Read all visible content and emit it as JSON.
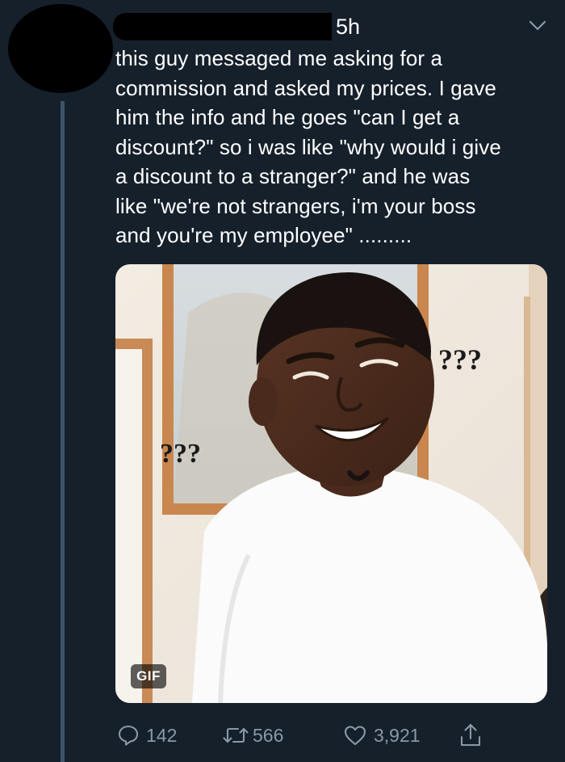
{
  "tweet": {
    "timestamp": "5h",
    "text": "this guy messaged me asking for a\ncommission and asked my prices. I gave\nhim the info and he goes \"can I get a\ndiscount?\" so i was like \"why would i give\na discount to a stranger?\" and he was\nlike \"we're not strangers, i'm your boss\nand you're my employee\" .........",
    "media": {
      "badge": "GIF",
      "caption_right": "???",
      "caption_left": "???"
    },
    "actions": {
      "replies": "142",
      "retweets": "566",
      "likes": "3,921"
    }
  },
  "colors": {
    "background": "#15202b",
    "secondary_text": "#8b98a5",
    "thread_line": "#3d5466"
  },
  "icons": [
    "reply-icon",
    "retweet-icon",
    "like-icon",
    "share-icon",
    "chevron-down-icon"
  ]
}
